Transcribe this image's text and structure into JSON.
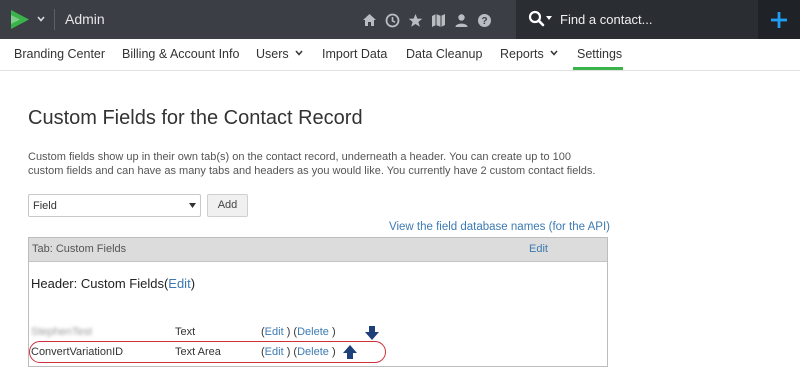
{
  "topbar": {
    "app_title": "Admin",
    "icons": [
      "home-icon",
      "history-icon",
      "star-icon",
      "map-icon",
      "person-icon",
      "help-icon"
    ],
    "search": {
      "placeholder": "Find a contact..."
    },
    "colors": {
      "bar": "#3b3f45",
      "search_bg": "#2a2d31",
      "logo_green": "#3ab34a",
      "add_icon": "#1e9ff2"
    }
  },
  "nav": {
    "items": [
      {
        "label": "Branding Center"
      },
      {
        "label": "Billing & Account Info"
      },
      {
        "label": "Users"
      },
      {
        "label": "Import Data"
      },
      {
        "label": "Data Cleanup"
      },
      {
        "label": "Reports"
      },
      {
        "label": "Settings"
      }
    ],
    "active": "Settings",
    "active_color": "#3ab34a"
  },
  "page": {
    "title": "Custom Fields for the Contact Record",
    "description": "Custom fields show up in their own tab(s) on the contact record, underneath a header. You can create up to 100 custom fields and can have as many tabs and headers as you would like. You currently have 2 custom contact fields.",
    "field_type_select": "Field",
    "add_button": "Add",
    "api_link": "View the field database names (for the API)"
  },
  "tab": {
    "label": "Tab: Custom Fields",
    "edit": "Edit"
  },
  "section": {
    "header_prefix": "Header: Custom Fields(",
    "header_edit": "Edit",
    "header_suffix": ")"
  },
  "rows": [
    {
      "name": "StephenTest",
      "type": "Text",
      "edit": "Edit",
      "delete": "Delete",
      "arrow": "down-arrow-icon"
    },
    {
      "name": "ConvertVariationID",
      "type": "Text Area",
      "edit": "Edit",
      "delete": "Delete",
      "arrow": "up-arrow-icon"
    }
  ],
  "link_color": "#3d7ab2",
  "highlight_color": "#d0303c"
}
